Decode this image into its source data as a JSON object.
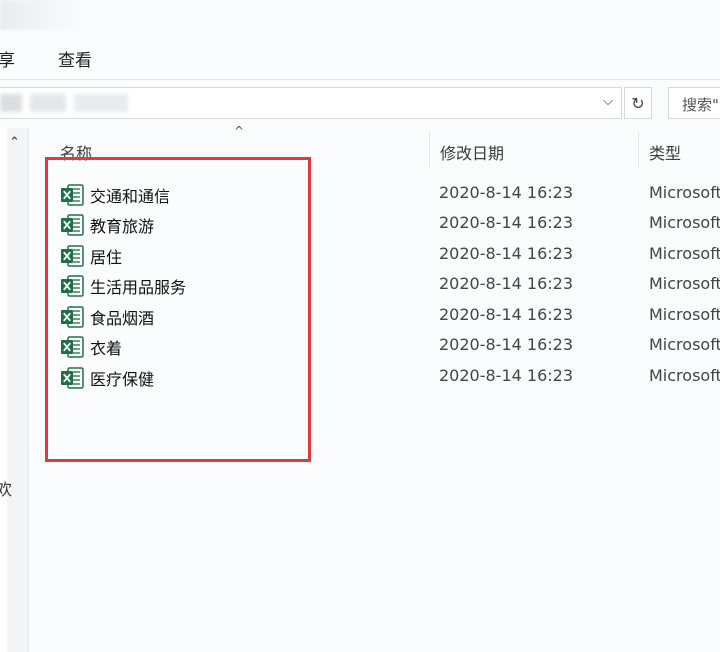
{
  "ribbon": {
    "tabs": [
      {
        "label": "享"
      },
      {
        "label": "查看"
      }
    ]
  },
  "address_bar": {
    "dropdown_glyph": "⌵",
    "refresh_glyph": "↻"
  },
  "search": {
    "placeholder": "搜索\""
  },
  "nav": {
    "scroll_up_glyph": "⌃",
    "cut_char": "欢"
  },
  "columns": {
    "name": "名称",
    "date": "修改日期",
    "type": "类型",
    "sort_glyph": "^"
  },
  "files": [
    {
      "name": "交通和通信",
      "date": "2020-8-14 16:23",
      "type": "Microsoft"
    },
    {
      "name": "教育旅游",
      "date": "2020-8-14 16:23",
      "type": "Microsoft"
    },
    {
      "name": "居住",
      "date": "2020-8-14 16:23",
      "type": "Microsoft"
    },
    {
      "name": "生活用品服务",
      "date": "2020-8-14 16:23",
      "type": "Microsoft"
    },
    {
      "name": "食品烟酒",
      "date": "2020-8-14 16:23",
      "type": "Microsoft"
    },
    {
      "name": "衣着",
      "date": "2020-8-14 16:23",
      "type": "Microsoft"
    },
    {
      "name": "医疗保健",
      "date": "2020-8-14 16:23",
      "type": "Microsoft"
    }
  ],
  "icons": {
    "file_icon": "excel-file-icon"
  },
  "colors": {
    "highlight": "#e03b3b",
    "excel_green": "#1e7145"
  }
}
